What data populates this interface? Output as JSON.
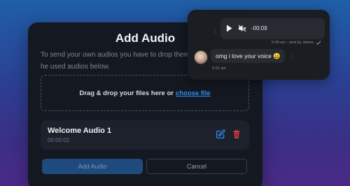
{
  "modal": {
    "title": "Add Audio",
    "description": "To send your own audios you have to drop them he used audios below.",
    "dropzone_text": "Drag & drop your files here or",
    "dropzone_link": "choose file",
    "audio_item": {
      "name": "Welcome Audio 1",
      "duration": "00:00:02",
      "edit_icon": "edit-icon",
      "delete_icon": "trash-icon"
    },
    "add_button": "Add Audio",
    "cancel_button": "Cancel"
  },
  "chat": {
    "audio_message": {
      "time": "-00:09",
      "meta": "6:49 am - sent by James",
      "status_icon": "check-icon"
    },
    "text_message": {
      "text": "omg i love your voice 😄",
      "time": "6:51 am"
    },
    "menu_icon": "more-vertical-icon"
  },
  "colors": {
    "accent": "#2f8ff0",
    "danger": "#e03a3a",
    "modal_bg": "#141820",
    "chat_bg": "#1a1d22"
  }
}
